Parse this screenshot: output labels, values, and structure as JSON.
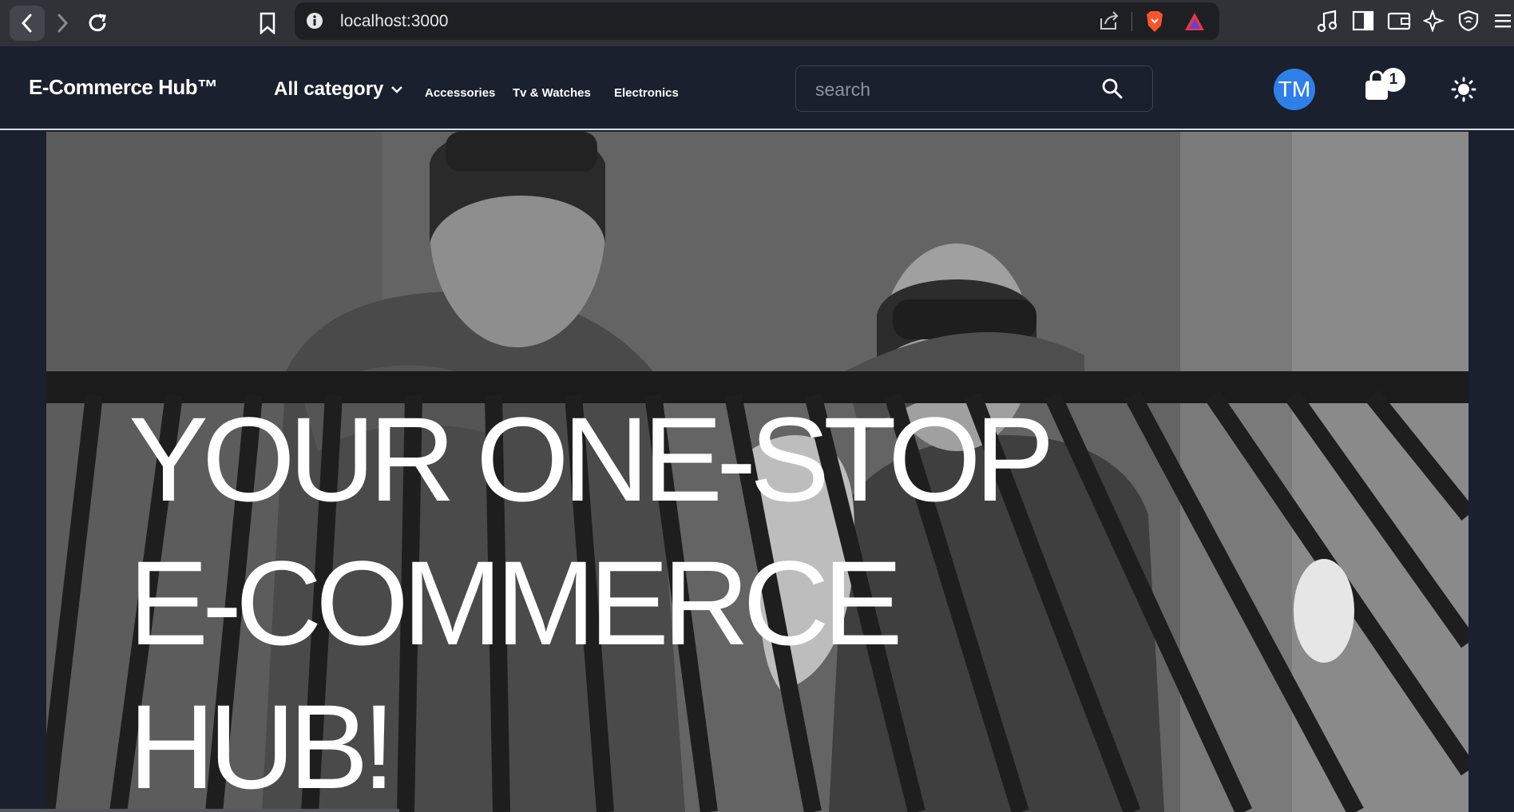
{
  "browser": {
    "url": "localhost:3000"
  },
  "site": {
    "brand": "E-Commerce Hub™",
    "category_menu": "All category",
    "nav_links": [
      "Accessories",
      "Tv & Watches",
      "Electronics"
    ],
    "search_placeholder": "search",
    "user_initials": "TM",
    "cart_count": "1"
  },
  "hero": {
    "headline_lines": [
      "YOUR ONE-STOP",
      "E-COMMERCE",
      "HUB!"
    ]
  },
  "colors": {
    "nav_bg": "#1a202e",
    "avatar_bg": "#2f7fe8",
    "chrome_bg": "#303238"
  }
}
